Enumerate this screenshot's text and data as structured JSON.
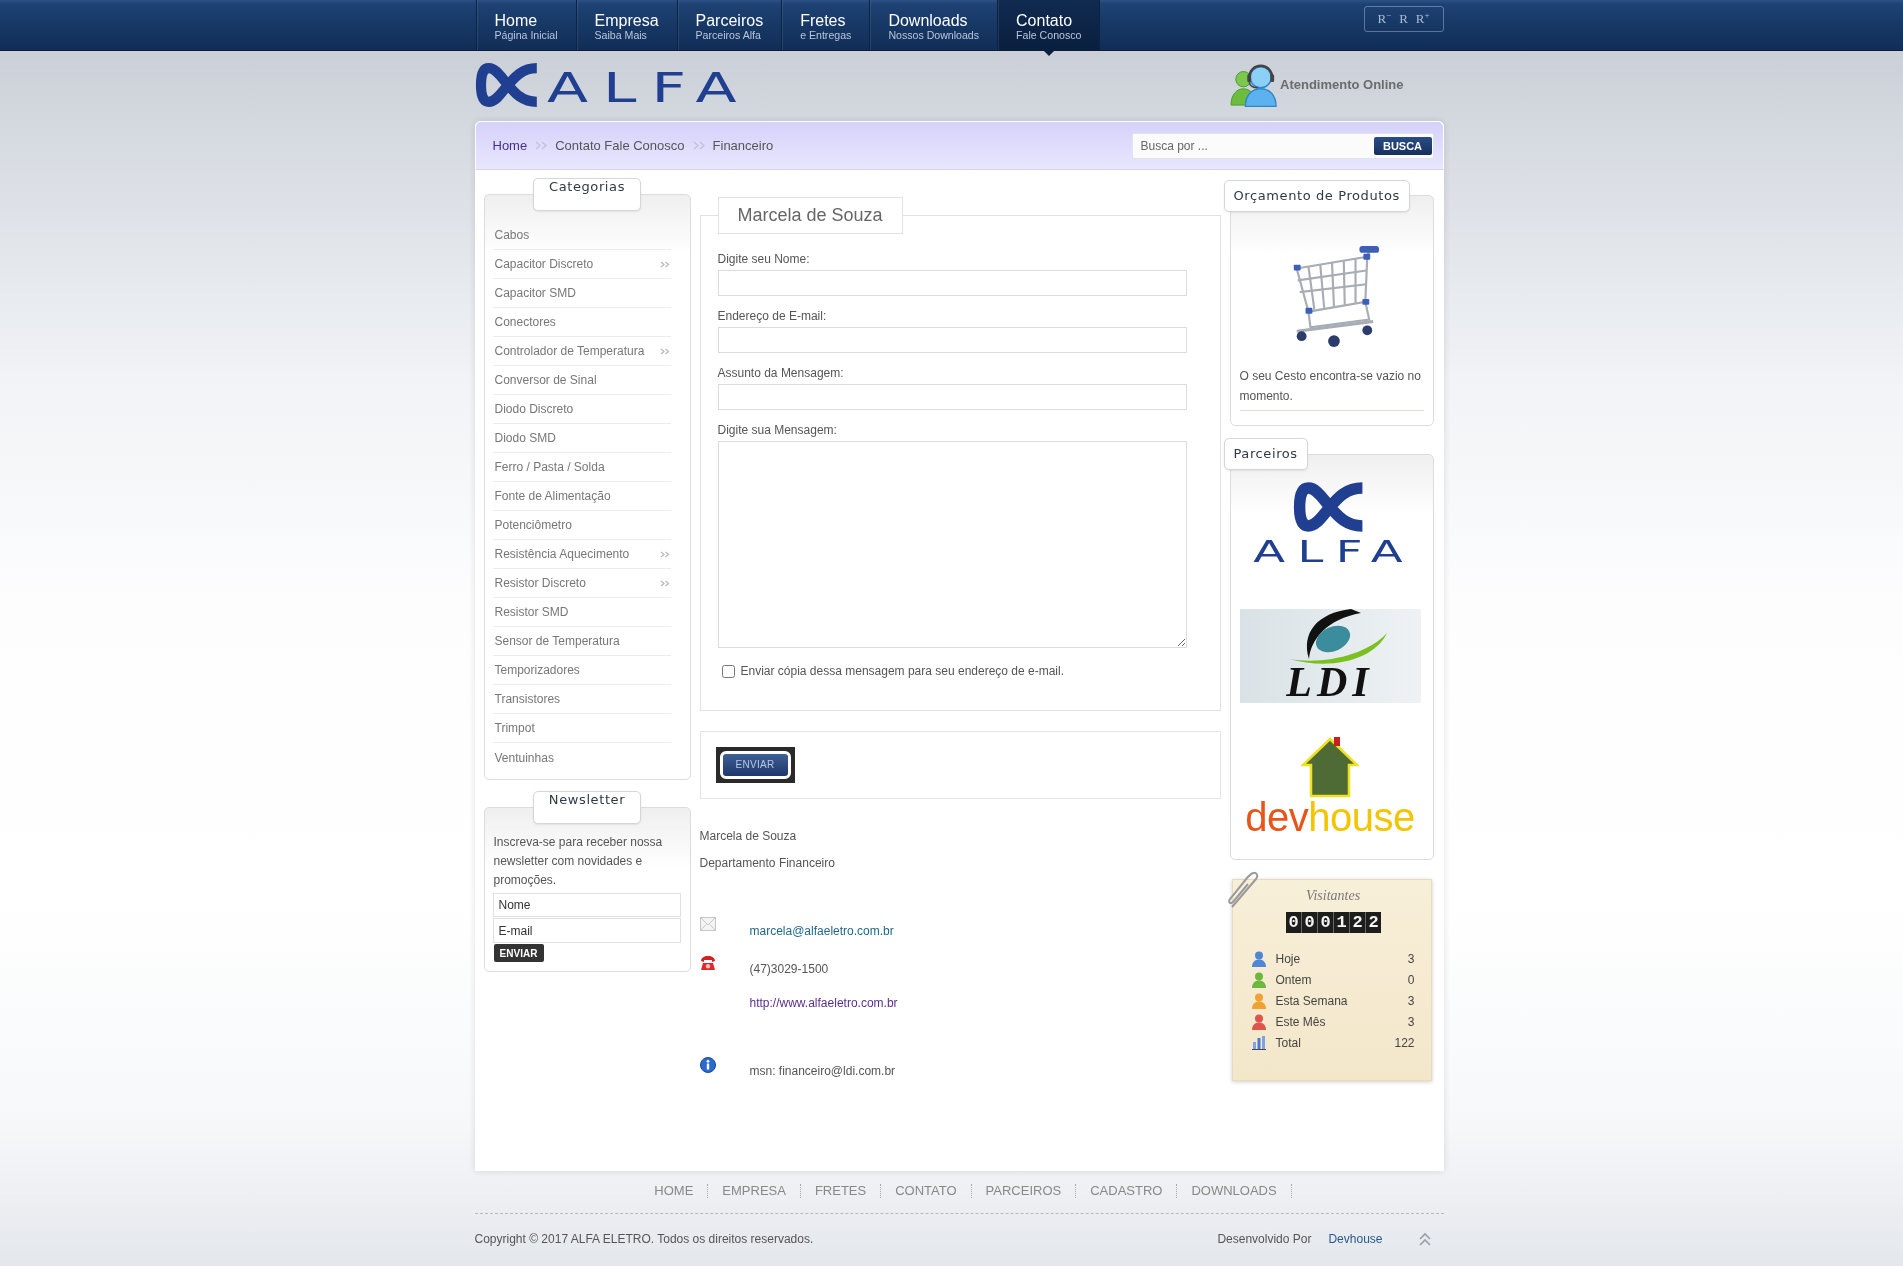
{
  "nav": {
    "tabs": [
      {
        "title": "Home",
        "subtitle": "Página Inicial",
        "selected": false
      },
      {
        "title": "Empresa",
        "subtitle": "Saiba Mais",
        "selected": false
      },
      {
        "title": "Parceiros",
        "subtitle": "Parceiros Alfa",
        "selected": false
      },
      {
        "title": "Fretes",
        "subtitle": "e Entregas",
        "selected": false
      },
      {
        "title": "Downloads",
        "subtitle": "Nossos Downloads",
        "selected": false
      },
      {
        "title": "Contato",
        "subtitle": "Fale Conosco",
        "selected": true
      }
    ]
  },
  "font_size_controls": [
    "R$^{−}$",
    "R",
    "R$^{+}$"
  ],
  "header": {
    "logo": "ALFA",
    "live_support": "Atendimento Online"
  },
  "breadcrumb": [
    {
      "label": "Home",
      "link": true
    },
    {
      "label": "Contato Fale Conosco",
      "link": false
    },
    {
      "label": "Financeiro",
      "link": false
    }
  ],
  "search": {
    "placeholder": "Busca por ...",
    "button": "BUSCA"
  },
  "categories": {
    "title": "Categorias",
    "items": [
      {
        "label": "Cabos",
        "submenu": false
      },
      {
        "label": "Capacitor Discreto",
        "submenu": true
      },
      {
        "label": "Capacitor SMD",
        "submenu": false
      },
      {
        "label": "Conectores",
        "submenu": false
      },
      {
        "label": "Controlador de Temperatura",
        "submenu": true
      },
      {
        "label": "Conversor de Sinal",
        "submenu": false
      },
      {
        "label": "Diodo Discreto",
        "submenu": false
      },
      {
        "label": "Diodo SMD",
        "submenu": false
      },
      {
        "label": "Ferro / Pasta / Solda",
        "submenu": false
      },
      {
        "label": "Fonte de Alimentação",
        "submenu": false
      },
      {
        "label": "Potenciômetro",
        "submenu": false
      },
      {
        "label": "Resistência Aquecimento",
        "submenu": true
      },
      {
        "label": "Resistor Discreto",
        "submenu": true
      },
      {
        "label": "Resistor SMD",
        "submenu": false
      },
      {
        "label": "Sensor de Temperatura",
        "submenu": false
      },
      {
        "label": "Temporizadores",
        "submenu": false
      },
      {
        "label": "Transistores",
        "submenu": false
      },
      {
        "label": "Trimpot",
        "submenu": false
      },
      {
        "label": "Ventuinhas",
        "submenu": false
      }
    ]
  },
  "newsletter": {
    "title": "Newsletter",
    "text": "Inscreva-se para receber nossa newsletter com novidades e promoções.",
    "fields": [
      {
        "placeholder": "Nome"
      },
      {
        "placeholder": "E-mail"
      }
    ],
    "button": "ENVIAR"
  },
  "contact_form": {
    "legend": "Marcela de Souza",
    "fields": [
      {
        "label": "Digite seu Nome:",
        "kind": "input"
      },
      {
        "label": "Endereço de E-mail:",
        "kind": "input"
      },
      {
        "label": "Assunto da Mensagem:",
        "kind": "input"
      },
      {
        "label": "Digite sua Mensagem:",
        "kind": "textarea"
      }
    ],
    "copy_checkbox": {
      "label": "Enviar cópia dessa mensagem para seu endereço de e-mail.",
      "checked": false
    },
    "submit": "ENVIAR"
  },
  "contact_info": {
    "name": "Marcela de Souza",
    "department": "Departamento Financeiro",
    "items": [
      {
        "kind": "email",
        "text": "marcela@alfaeletro.com.br"
      },
      {
        "kind": "phone",
        "text": "(47)3029-1500"
      },
      {
        "kind": "web",
        "text": "http://www.alfaeletro.com.br"
      },
      {
        "kind": "msn",
        "text": "msn: financeiro@ldi.com.br"
      }
    ]
  },
  "quote": {
    "title": "Orçamento de Produtos",
    "text": "O seu Cesto encontra-se vazio no momento."
  },
  "partners": {
    "title": "Parceiros",
    "logos": [
      {
        "kind": "alfa",
        "segments": [
          {
            "text": "ALFA"
          }
        ]
      },
      {
        "kind": "ldi",
        "segments": [
          {
            "text": "LDI"
          }
        ]
      },
      {
        "kind": "devhouse",
        "segments": [
          {
            "text": "dev",
            "color": "#e9541a"
          },
          {
            "text": "house",
            "color": "#f3c500"
          }
        ]
      }
    ]
  },
  "visitors": {
    "title": "Visitantes",
    "counter": "000122",
    "rows": [
      {
        "kind": "user",
        "label": "Hoje",
        "value": "3",
        "color": "#4f86d6"
      },
      {
        "kind": "user",
        "label": "Ontem",
        "value": "0",
        "color": "#6cb83c"
      },
      {
        "kind": "user",
        "label": "Esta Semana",
        "value": "3",
        "color": "#f0a232"
      },
      {
        "kind": "user",
        "label": "Este Mês",
        "value": "3",
        "color": "#e0544c"
      },
      {
        "kind": "chart",
        "label": "Total",
        "value": "122"
      }
    ]
  },
  "footer": {
    "links": [
      "HOME",
      "EMPRESA",
      "FRETES",
      "CONTATO",
      "PARCEIROS",
      "CADASTRO",
      "DOWNLOADS"
    ],
    "copyright": "Copyright © 2017 ALFA ELETRO. Todos os direitos reservados.",
    "developed_by": "Desenvolvido Por",
    "developer": "Devhouse"
  }
}
